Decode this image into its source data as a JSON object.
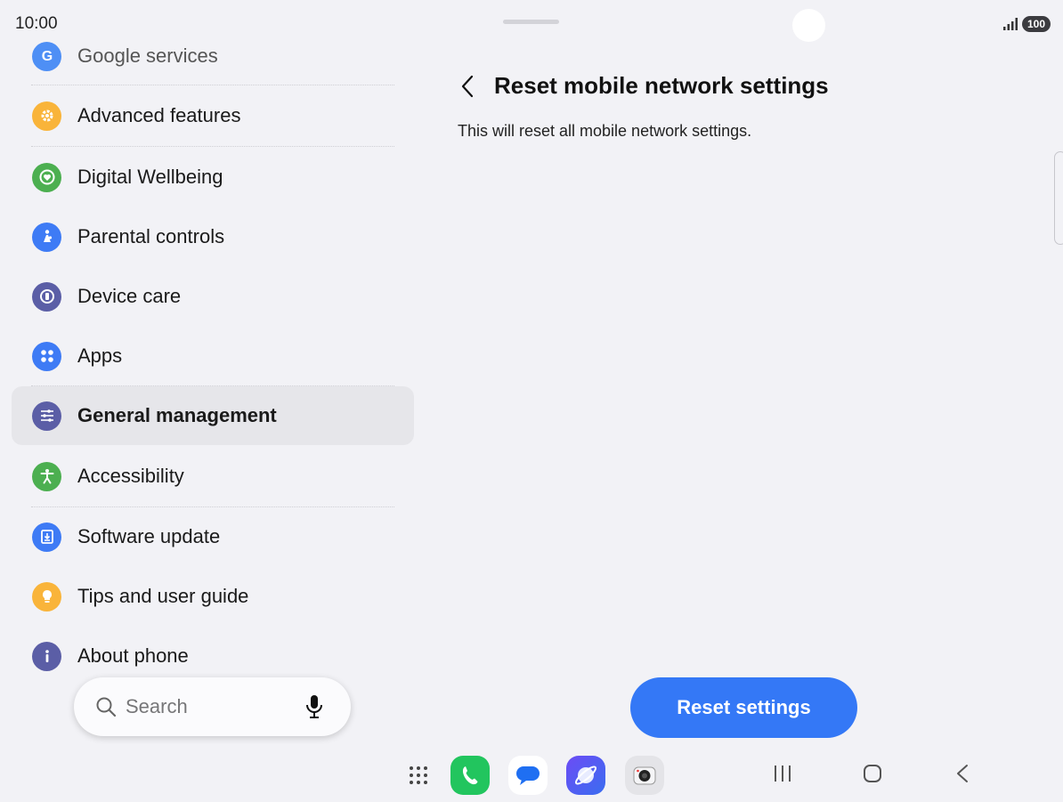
{
  "status_bar": {
    "time": "10:00",
    "battery": "100"
  },
  "sidebar": {
    "items": [
      {
        "label": "Google services",
        "icon": "google-icon",
        "color": "#4285f4"
      },
      {
        "label": "Advanced features",
        "icon": "gear-icon",
        "color": "#f9b43a"
      },
      {
        "label": "Digital Wellbeing",
        "icon": "heart-icon",
        "color": "#4caf50"
      },
      {
        "label": "Parental controls",
        "icon": "parent-child-icon",
        "color": "#3e7bf5"
      },
      {
        "label": "Device care",
        "icon": "device-care-icon",
        "color": "#5b5ea6"
      },
      {
        "label": "Apps",
        "icon": "apps-icon",
        "color": "#3e7bf5"
      },
      {
        "label": "General management",
        "icon": "sliders-icon",
        "color": "#5b5ea6",
        "selected": true
      },
      {
        "label": "Accessibility",
        "icon": "accessibility-icon",
        "color": "#4caf50"
      },
      {
        "label": "Software update",
        "icon": "download-icon",
        "color": "#3e7bf5"
      },
      {
        "label": "Tips and user guide",
        "icon": "lightbulb-icon",
        "color": "#f9b43a"
      },
      {
        "label": "About phone",
        "icon": "info-icon",
        "color": "#5b5ea6"
      }
    ]
  },
  "search": {
    "placeholder": "Search"
  },
  "content": {
    "title": "Reset mobile network settings",
    "description": "This will reset all mobile network settings.",
    "reset_button_label": "Reset settings"
  },
  "colors": {
    "accent": "#3478f6",
    "background": "#f2f2f6",
    "selected_row": "#e6e6ea"
  },
  "dock": {
    "apps": [
      {
        "name": "app-drawer-icon"
      },
      {
        "name": "phone-app-icon"
      },
      {
        "name": "messages-app-icon"
      },
      {
        "name": "internet-app-icon"
      },
      {
        "name": "camera-app-icon"
      }
    ]
  }
}
